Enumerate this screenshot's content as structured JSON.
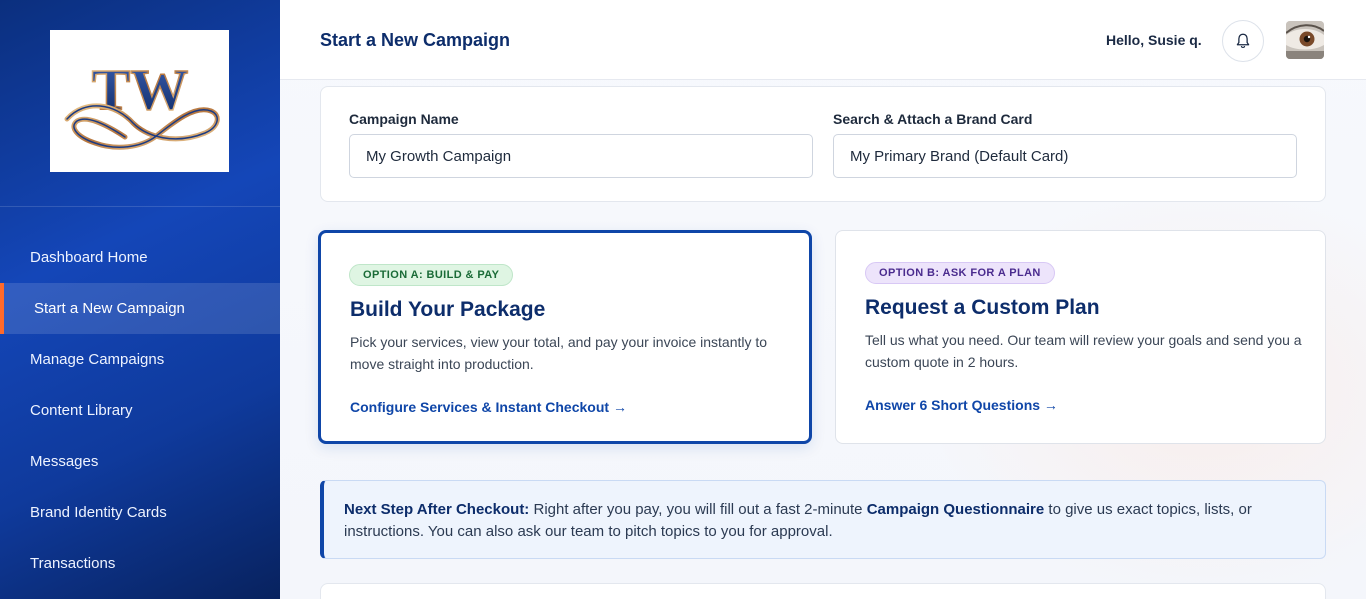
{
  "sidebar": {
    "logo_text": "TW",
    "items": [
      {
        "label": "Dashboard Home"
      },
      {
        "label": "Start a New Campaign"
      },
      {
        "label": "Manage Campaigns"
      },
      {
        "label": "Content Library"
      },
      {
        "label": "Messages"
      },
      {
        "label": "Brand Identity Cards"
      },
      {
        "label": "Transactions"
      }
    ],
    "active_index": 1
  },
  "header": {
    "title": "Start a New Campaign",
    "greeting": "Hello, Susie q.",
    "bell_icon": "bell-icon",
    "avatar_icon": "user-avatar"
  },
  "form": {
    "campaign_name_label": "Campaign Name",
    "campaign_name_value": "My Growth Campaign",
    "brand_card_label": "Search & Attach a Brand Card",
    "brand_card_value": "My Primary Brand (Default Card)"
  },
  "options": {
    "a": {
      "badge": "OPTION A: BUILD & PAY",
      "title": "Build Your Package",
      "description": "Pick your services, view your total, and pay your invoice instantly to move straight into production.",
      "link": "Configure Services & Instant Checkout →"
    },
    "b": {
      "badge": "OPTION B: ASK FOR A PLAN",
      "title": "Request a Custom Plan",
      "description": "Tell us what you need. Our team will review your goals and send you a custom quote in 2 hours.",
      "link": "Answer 6 Short Questions →"
    }
  },
  "callout": {
    "lead": "Next Step After Checkout:",
    "text_1": " Right after you pay, you will fill out a fast 2-minute ",
    "emphasis": "Campaign Questionnaire",
    "text_2": " to give us exact topics, lists, or instructions. You can also ask our team to pitch topics to you for approval."
  },
  "colors": {
    "accent": "#0f46a8",
    "active_marker": "#ff6a2b",
    "title": "#0d2d6b"
  }
}
